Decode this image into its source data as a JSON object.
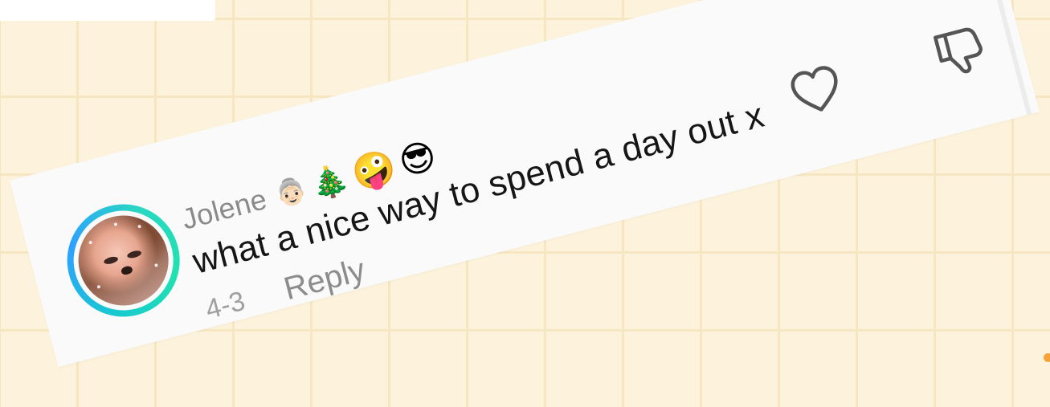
{
  "comment": {
    "username": "Jolene",
    "username_emojis": [
      {
        "char": "👵🏻",
        "name": "mrs-claus-emoji"
      },
      {
        "char": "🎄",
        "name": "christmas-tree-emoji"
      },
      {
        "char": "🤪",
        "name": "zany-face-emoji"
      },
      {
        "char": "😎",
        "name": "sunglasses-face-emoji"
      }
    ],
    "text": "what a nice way to spend a day out x",
    "date": "4-3",
    "reply_label": "Reply",
    "icons": {
      "like": "heart-outline-icon",
      "dislike": "thumbs-down-outline-icon"
    },
    "avatar_ring_colors": [
      "#18c7d3",
      "#2ea0ff",
      "#1fe2b0"
    ]
  },
  "colors": {
    "background": "#fdf3dc",
    "grid_lines": "#f6e6c2",
    "card": "#fafafa",
    "accent_dot": "#f4a23a"
  }
}
